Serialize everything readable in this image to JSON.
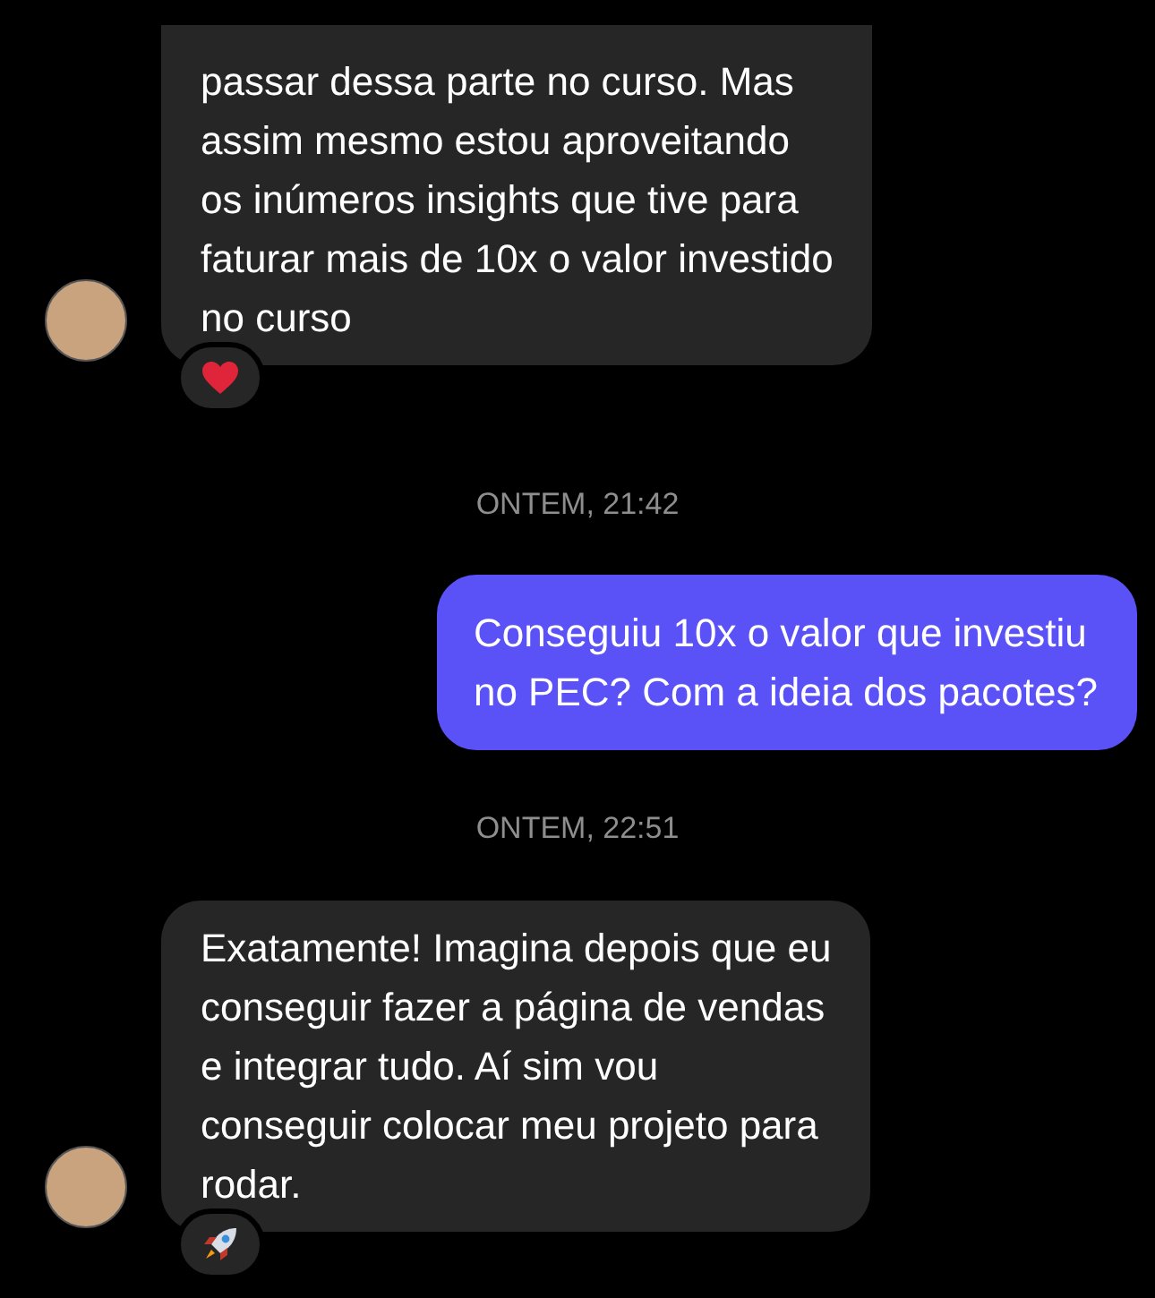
{
  "messages": [
    {
      "kind": "incoming",
      "cut_top": true,
      "lines": [
        "passar dessa parte no curso. Mas",
        "assim mesmo estou aproveitando",
        "os inúmeros insights que tive para",
        "faturar mais de 10x o valor investido",
        "no curso"
      ],
      "reaction": {
        "kind": "heart"
      }
    },
    {
      "kind": "time",
      "text": "ONTEM, 21:42"
    },
    {
      "kind": "outgoing",
      "lines": [
        "Conseguiu 10x o valor que investiu",
        "no PEC? Com a ideia dos pacotes?"
      ]
    },
    {
      "kind": "time",
      "text": "ONTEM, 22:51"
    },
    {
      "kind": "incoming",
      "lines": [
        "Exatamente! Imagina depois que eu",
        "conseguir fazer a página de vendas",
        "e integrar tudo. Aí sim vou",
        "conseguir colocar meu projeto para",
        "rodar."
      ],
      "reaction": {
        "kind": "rocket"
      }
    }
  ]
}
